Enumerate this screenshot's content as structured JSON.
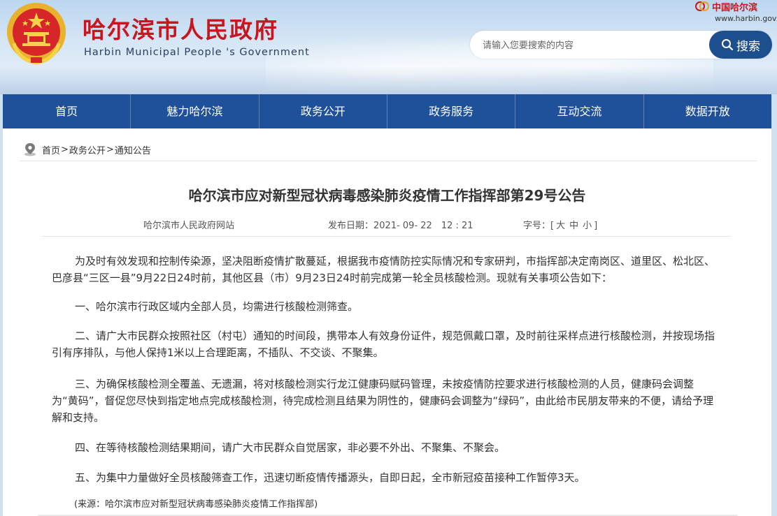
{
  "header": {
    "site_title": "哈尔滨市人民政府",
    "site_subtitle": "Harbin Municipal People 's Government",
    "gov_logo_text": "中国哈尔滨",
    "gov_url": "www.harbin.gov.cn",
    "search_placeholder": "请输入您要搜索的内容",
    "search_button_label": "搜索"
  },
  "nav": {
    "items": [
      "首页",
      "魅力哈尔滨",
      "政务公开",
      "政务服务",
      "互动交流",
      "数据开放"
    ]
  },
  "breadcrumb": {
    "home": "首页",
    "sep1": ">",
    "section": "政务公开",
    "sep2": ">",
    "current": "通知公告"
  },
  "article": {
    "title": "哈尔滨市应对新型冠状病毒感染肺炎疫情工作指挥部第29号公告",
    "meta_source": "哈尔滨市人民政府网站",
    "meta_date": "发布日期：2021- 09- 22　12 : 21",
    "font_size_label": "字号：[",
    "font_size_large": "大",
    "font_size_medium": "中",
    "font_size_small": "小",
    "font_size_close": "]",
    "paragraphs": [
      "为及时有效发现和控制传染源，坚决阻断疫情扩散蔓延，根据我市疫情防控实际情况和专家研判，市指挥部决定南岗区、道里区、松北区、巴彦县“三区一县”9月22日24时前，其他区县（市）9月23日24时前完成第一轮全员核酸检测。现就有关事项公告如下：",
      "一、哈尔滨市行政区域内全部人员，均需进行核酸检测筛查。",
      "二、请广大市民群众按照社区（村屯）通知的时间段，携带本人有效身份证件，规范佩戴口罩，及时前往采样点进行核酸检测，并按现场指引有序排队，与他人保持1米以上合理距离，不插队、不交谈、不聚集。",
      "三、为确保核酸检测全覆盖、无遗漏，将对核酸检测实行龙江健康码赋码管理，未按疫情防控要求进行核酸检测的人员，健康码会调整为“黄码”，督促您尽快到指定地点完成核酸检测，待完成检测且结果为阴性的，健康码会调整为“绿码”，由此给市民朋友带来的不便，请给予理解和支持。",
      "四、在等待核酸检测结果期间，请广大市民群众自觉居家，非必要不外出、不聚集、不聚会。",
      "五、为集中力量做好全员核酸筛查工作，迅速切断疫情传播源头，自即日起，全市新冠疫苗接种工作暂停3天。"
    ],
    "source": "(来源：哈尔滨市应对新型冠状病毒感染肺炎疫情工作指挥部)"
  },
  "colors": {
    "title_red": "#c8161e",
    "nav_blue": "#1e5199",
    "search_blue": "#1d4f8f"
  },
  "icons": [
    "national-emblem-icon",
    "location-pin-icon",
    "search-icon"
  ]
}
